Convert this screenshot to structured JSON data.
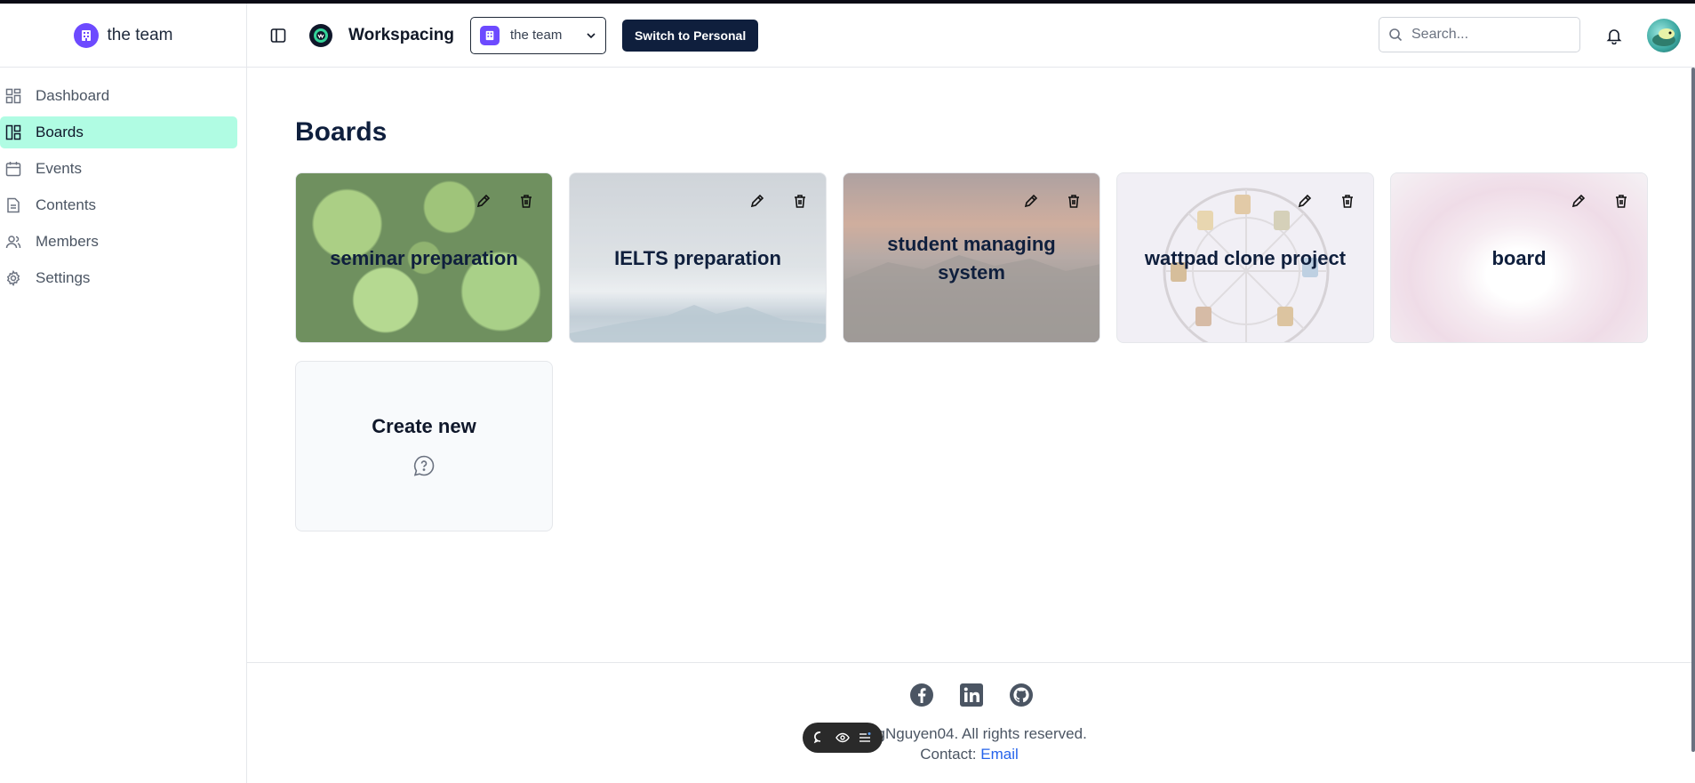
{
  "sidebar": {
    "team_name": "the team",
    "items": [
      {
        "label": "Dashboard",
        "icon": "dashboard-icon"
      },
      {
        "label": "Boards",
        "icon": "boards-icon",
        "active": true
      },
      {
        "label": "Events",
        "icon": "calendar-icon"
      },
      {
        "label": "Contents",
        "icon": "document-icon"
      },
      {
        "label": "Members",
        "icon": "users-icon"
      },
      {
        "label": "Settings",
        "icon": "gear-icon"
      }
    ]
  },
  "header": {
    "brand": "Workspacing",
    "team_select": "the team",
    "switch_button": "Switch to Personal",
    "search_placeholder": "Search..."
  },
  "main": {
    "title": "Boards",
    "boards": [
      {
        "title": "seminar preparation",
        "theme": "green-leaves"
      },
      {
        "title": "IELTS preparation",
        "theme": "misty-mountains"
      },
      {
        "title": "student managing system",
        "theme": "sunset-mountains"
      },
      {
        "title": "wattpad clone project",
        "theme": "ferris-wheel"
      },
      {
        "title": "board",
        "theme": "pink-petals"
      }
    ],
    "create_new": "Create new"
  },
  "footer": {
    "copyright": "hungNguyen04. All rights reserved.",
    "contact_label": "Contact: ",
    "contact_link": "Email"
  },
  "colors": {
    "accent": "#b0fce3",
    "primary_dark": "#0f1f3d",
    "team_purple": "#6d4aff",
    "link": "#2563eb"
  }
}
